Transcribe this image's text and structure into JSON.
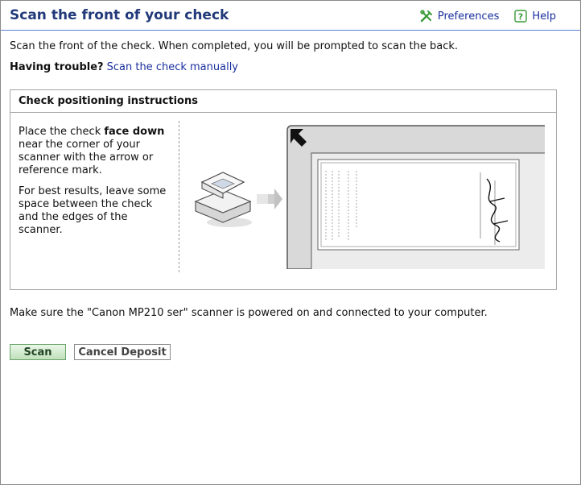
{
  "header": {
    "title": "Scan the front of your check",
    "preferences_label": "Preferences",
    "help_label": "Help"
  },
  "intro": {
    "instructions": "Scan the front of the check. When completed, you will be prompted to scan the back.",
    "trouble_label": "Having trouble?",
    "manual_link": "Scan the check manually"
  },
  "panel": {
    "heading": "Check positioning instructions",
    "para1_before": "Place the check ",
    "para1_bold": "face down",
    "para1_after": " near the corner of your scanner with the arrow or reference mark.",
    "para2": "For best results, leave some space between the check and the edges of the scanner."
  },
  "status": "Make sure the \"Canon MP210 ser\" scanner is powered on and connected to your computer.",
  "buttons": {
    "scan": "Scan",
    "cancel": "Cancel Deposit"
  },
  "colors": {
    "title": "#223a7a",
    "link": "#1a2f9e",
    "rule": "#5b7fd0",
    "icon_green": "#3a9a3a"
  },
  "icons": [
    "tools-icon",
    "help-icon",
    "scanner-icon",
    "arrow-right-icon",
    "corner-arrow-icon"
  ]
}
